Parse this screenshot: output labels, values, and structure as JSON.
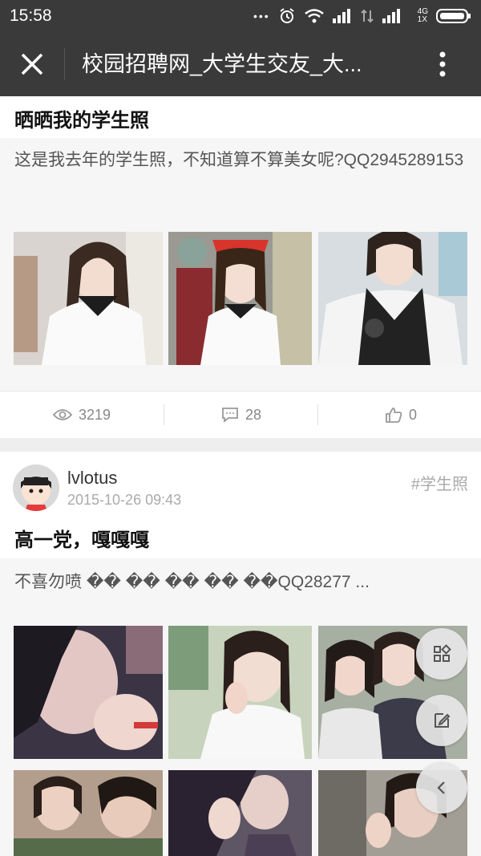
{
  "status_bar": {
    "time": "15:58",
    "network_label": "4G",
    "network_sub": "1X"
  },
  "nav": {
    "title": "校园招聘网_大学生交友_大..."
  },
  "post1": {
    "title": "晒晒我的学生照",
    "excerpt": "这是我去年的学生照，不知道算不算美女呢?QQ2945289153",
    "views": "3219",
    "comments": "28",
    "likes": "0"
  },
  "post2": {
    "author": "lvlotus",
    "date": "2015-10-26 09:43",
    "tag": "#学生照",
    "title": "高一党，嘎嘎嘎",
    "excerpt": "不喜勿喷 �� �� �� �� ��QQ28277 ..."
  },
  "icons": {
    "close": "close-icon",
    "more": "more-vertical-icon",
    "views": "eye-icon",
    "comments": "comment-icon",
    "likes": "thumbs-up-icon",
    "grid": "grid-icon",
    "edit": "edit-icon",
    "back": "chevron-left-icon"
  },
  "colors": {
    "header_bg": "#3a3a3a",
    "page_bg": "#eeeeee",
    "muted_text": "#888888"
  }
}
